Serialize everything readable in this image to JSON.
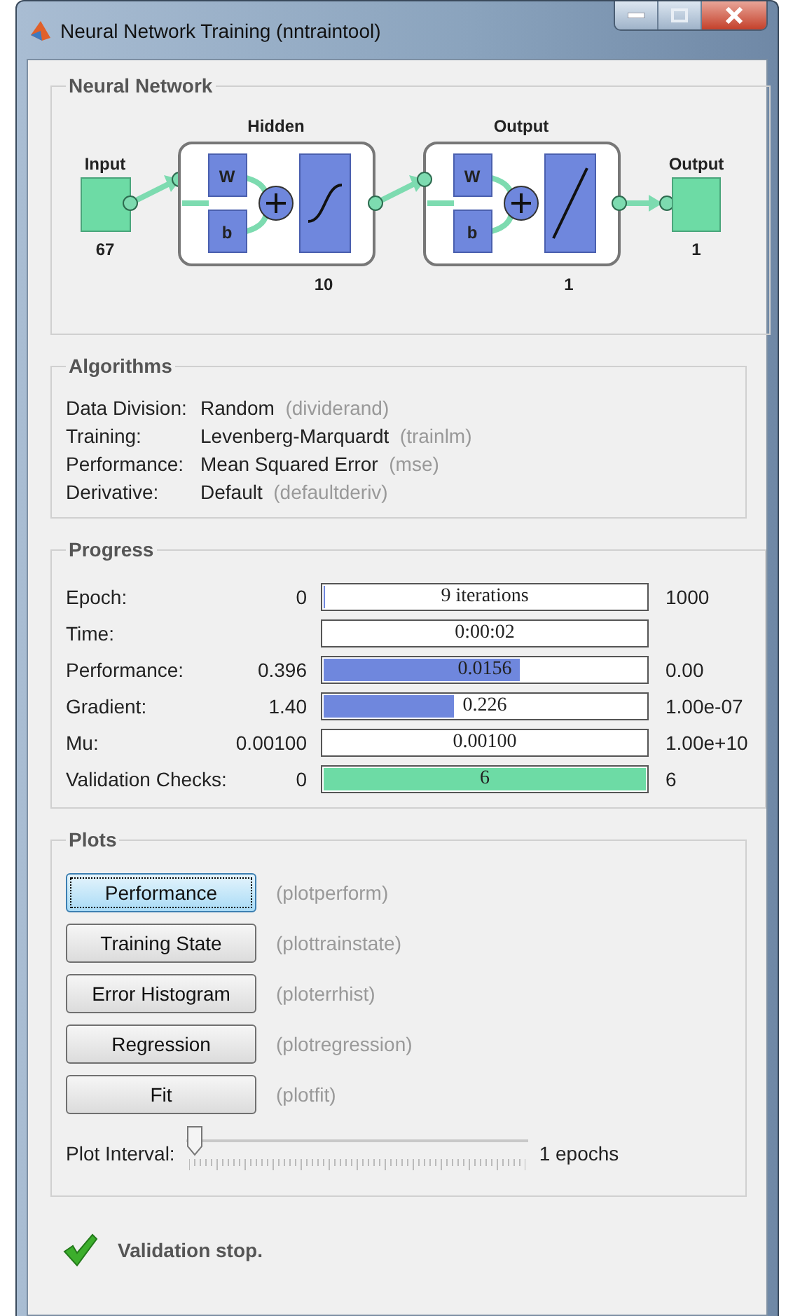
{
  "window": {
    "title": "Neural Network Training (nntraintool)"
  },
  "network": {
    "title": "Neural Network",
    "input": {
      "label": "Input",
      "size": "67"
    },
    "layers": [
      {
        "title": "Hidden",
        "weight": "W",
        "bias": "b",
        "kind": "sigmoid",
        "size": "10"
      },
      {
        "title": "Output",
        "weight": "W",
        "bias": "b",
        "kind": "linear",
        "size": "1"
      }
    ],
    "output": {
      "label": "Output",
      "size": "1"
    }
  },
  "algorithms": {
    "title": "Algorithms",
    "rows": [
      {
        "label": "Data Division:",
        "value": "Random",
        "function": "(dividerand)"
      },
      {
        "label": "Training:",
        "value": "Levenberg-Marquardt",
        "function": "(trainlm)"
      },
      {
        "label": "Performance:",
        "value": "Mean Squared Error",
        "function": "(mse)"
      },
      {
        "label": "Derivative:",
        "value": "Default",
        "function": "(defaultderiv)"
      }
    ]
  },
  "progress": {
    "title": "Progress",
    "rows": [
      {
        "label": "Epoch:",
        "start": "0",
        "bar": "9 iterations",
        "end": "1000",
        "level": 0.009,
        "color": "#6f87dd"
      },
      {
        "label": "Time:",
        "bar": "0:00:02"
      },
      {
        "label": "Performance:",
        "start": "0.396",
        "bar": "0.0156",
        "end": "0.00",
        "level": 0.61,
        "color": "#6f87dd"
      },
      {
        "label": "Gradient:",
        "start": "1.40",
        "bar": "0.226",
        "end": "1.00e-07",
        "level": 0.41,
        "color": "#6f87dd"
      },
      {
        "label": "Mu:",
        "start": "0.00100",
        "bar": "0.00100",
        "end": "1.00e+10"
      },
      {
        "label": "Validation Checks:",
        "start": "0",
        "bar": "6",
        "end": "6",
        "level": 1,
        "color": "#6ddba5"
      }
    ]
  },
  "plots": {
    "title": "Plots",
    "buttons": [
      {
        "label": "Performance",
        "function": "(plotperform)",
        "selected": true
      },
      {
        "label": "Training State",
        "function": "(plottrainstate)",
        "selected": false
      },
      {
        "label": "Error Histogram",
        "function": "(ploterrhist)",
        "selected": false
      },
      {
        "label": "Regression",
        "function": "(plotregression)",
        "selected": false
      },
      {
        "label": "Fit",
        "function": "(plotfit)",
        "selected": false
      }
    ],
    "interval": {
      "label": "Plot Interval:",
      "level": 0,
      "reading": "1 epochs"
    }
  },
  "status": {
    "text": "Validation stop."
  }
}
